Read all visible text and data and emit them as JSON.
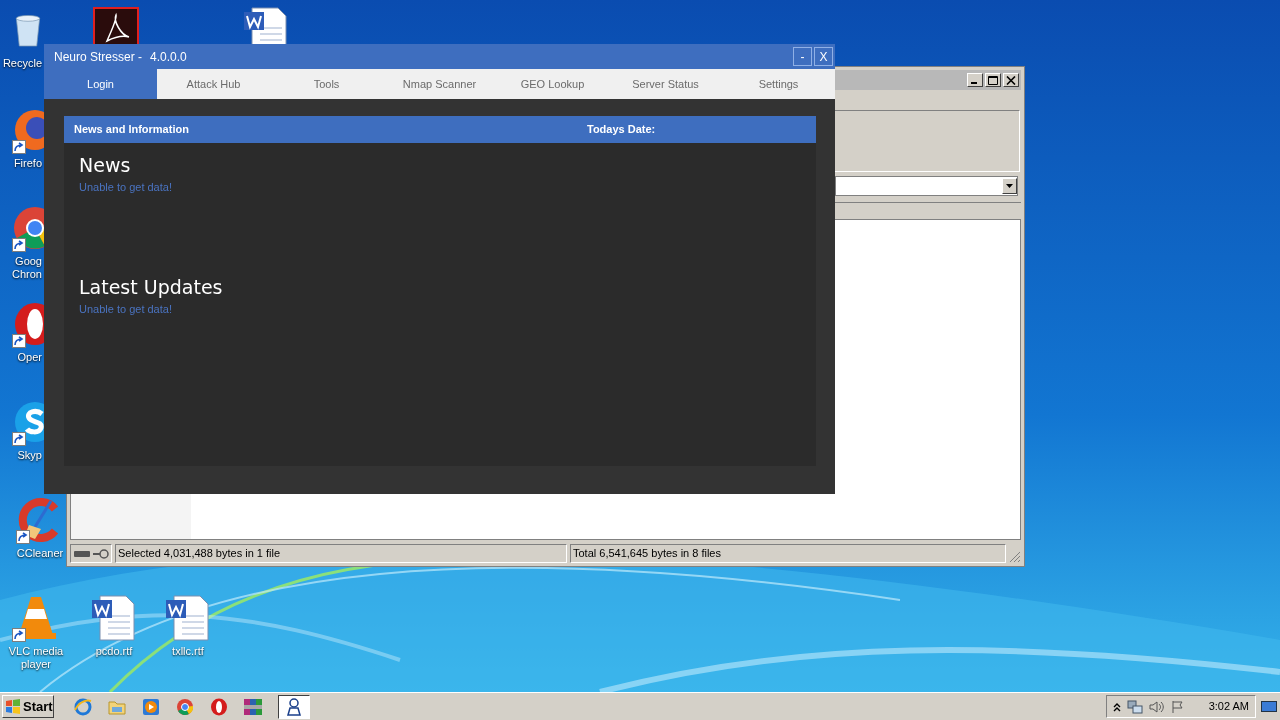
{
  "desktop_icons": [
    {
      "kind": "recycle",
      "lines": [
        "Recycle"
      ]
    },
    {
      "kind": "pdf"
    },
    {
      "kind": "word"
    },
    {
      "kind": "firefox",
      "lines": [
        "Firefo"
      ]
    },
    {
      "kind": "chrome",
      "lines": [
        "Goog",
        "Chron"
      ]
    },
    {
      "kind": "opera",
      "lines": [
        "Oper"
      ]
    },
    {
      "kind": "skype",
      "lines": [
        "Skyp"
      ]
    },
    {
      "kind": "ccleaner",
      "lines": [
        "CCleaner"
      ]
    },
    {
      "kind": "vlc",
      "lines": [
        "VLC media",
        "player"
      ]
    },
    {
      "kind": "word",
      "lines": [
        "pcdo.rtf"
      ]
    },
    {
      "kind": "word",
      "lines": [
        "txllc.rtf"
      ]
    }
  ],
  "file_window": {
    "status": [
      "Selected 4,031,488 bytes in 1 file",
      "Total 6,541,645 bytes in 8 files"
    ]
  },
  "app_window": {
    "title": "Neuro Stresser -",
    "version": "4.0.0.0",
    "buttons": [
      "-",
      "X"
    ],
    "tabs": [
      {
        "label": "Login",
        "selected": true
      },
      {
        "label": "Attack Hub",
        "selected": false
      },
      {
        "label": "Tools",
        "selected": false
      },
      {
        "label": "Nmap Scanner",
        "selected": false
      },
      {
        "label": "GEO Lookup",
        "selected": false
      },
      {
        "label": "Server Status",
        "selected": false
      },
      {
        "label": "Settings",
        "selected": false
      }
    ],
    "panel": {
      "header": "News and Information",
      "date_label": "Todays Date:",
      "sections": [
        {
          "heading": "News",
          "message": "Unable to get data!"
        },
        {
          "heading": "Latest Updates",
          "message": "Unable to get data!"
        }
      ]
    }
  },
  "taskbar": {
    "start": "Start",
    "apps": [
      {
        "kind": "ie",
        "selected": false
      },
      {
        "kind": "folder",
        "selected": false
      },
      {
        "kind": "media",
        "selected": false
      },
      {
        "kind": "chrome",
        "selected": false
      },
      {
        "kind": "opera",
        "selected": false
      },
      {
        "kind": "archive",
        "selected": false
      },
      {
        "kind": "app",
        "selected": true
      }
    ],
    "clock": "3:02 AM"
  }
}
